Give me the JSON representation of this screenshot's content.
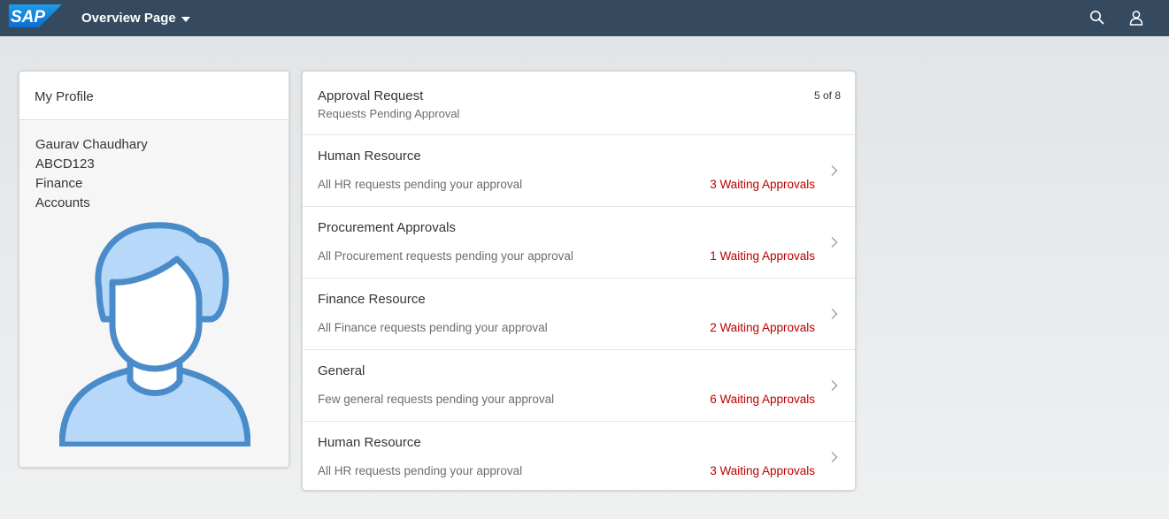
{
  "shell": {
    "logo_text": "SAP",
    "title": "Overview Page",
    "colors": {
      "bar": "#354a5f",
      "logo": "#0a6ed1"
    },
    "icons": [
      "chevron-down-icon",
      "search-icon",
      "user-icon"
    ]
  },
  "profile": {
    "title": "My Profile",
    "name": "Gaurav Chaudhary",
    "id": "ABCD123",
    "department": "Finance",
    "team": "Accounts",
    "avatar_icon": "user-avatar-icon"
  },
  "approvals": {
    "title": "Approval Request",
    "subtitle": "Requests Pending Approval",
    "count": "5 of 8",
    "status_color": "#bb0000",
    "items": [
      {
        "title": "Human Resource",
        "description": "All HR requests pending your approval",
        "status": "3 Waiting Approvals"
      },
      {
        "title": "Procurement Approvals",
        "description": "All Procurement requests pending your approval",
        "status": "1 Waiting Approvals"
      },
      {
        "title": "Finance Resource",
        "description": "All Finance requests pending your approval",
        "status": "2 Waiting Approvals"
      },
      {
        "title": "General",
        "description": "Few general requests pending your approval",
        "status": "6 Waiting Approvals"
      },
      {
        "title": "Human Resource",
        "description": "All HR requests pending your approval",
        "status": "3 Waiting Approvals"
      }
    ]
  }
}
